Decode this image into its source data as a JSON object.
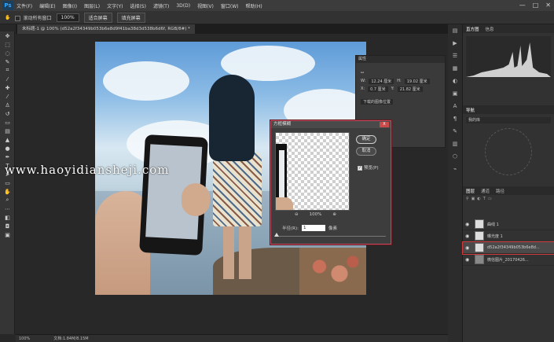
{
  "app": {
    "logo": "Ps"
  },
  "menu": [
    "文件(F)",
    "编辑(E)",
    "图像(I)",
    "图层(L)",
    "文字(Y)",
    "选择(S)",
    "滤镜(T)",
    "3D(D)",
    "视图(V)",
    "窗口(W)",
    "帮助(H)"
  ],
  "window_controls": [
    "—",
    "□",
    "✕"
  ],
  "options": {
    "scroll_all_windows": "滚动所有窗口",
    "zoom_value": "100%",
    "fit_screen": "适合屏幕",
    "fill_screen": "填充屏幕"
  },
  "document_tab": "未标题-1 @ 100% (d52a2f34349b053b6e8d9f41ba38d3d538b6d6f, RGB/8#) *",
  "watermark": "www.haoyidiansheji.com",
  "status": {
    "zoom": "100%",
    "doc": "文档:1.84M/8.15M"
  },
  "properties": {
    "title": "属性",
    "w": "12.24 厘米",
    "h": "19.02 厘米",
    "x": "0.7 厘米",
    "y": "21.82 厘米",
    "link": "下载的图像位置"
  },
  "dialog": {
    "title": "方框模糊",
    "close": "X",
    "ok": "确定",
    "cancel": "取消",
    "preview": "预览(P)",
    "zoom": "100%",
    "zoom_in": "⊕",
    "zoom_out": "⊖",
    "radius_label": "半径(R):",
    "radius_value": "1",
    "radius_unit": "像素"
  },
  "panels": {
    "histogram_tabs": [
      "直方图",
      "信息"
    ],
    "nav_tabs": [
      "导航"
    ],
    "nav_preset": "我的库",
    "layer_tabs": [
      "图层",
      "通道",
      "路径"
    ],
    "layers": [
      {
        "name": "曲线 1",
        "thumb": "light"
      },
      {
        "name": "曝光度 1",
        "thumb": "light"
      },
      {
        "name": "d52a2f34349b053b6e8d...",
        "thumb": "light",
        "selected": true
      },
      {
        "name": "微信图片_20170426...",
        "thumb": "dark"
      }
    ]
  }
}
